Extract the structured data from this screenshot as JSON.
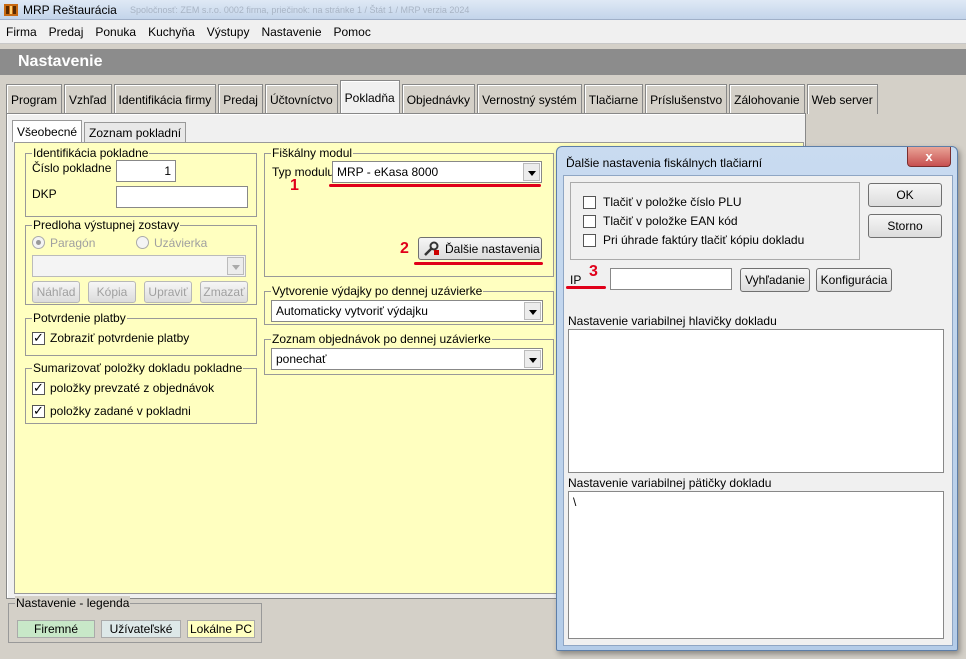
{
  "window": {
    "title": "MRP Reštaurácia",
    "title_extra": "Spoločnosť: ZEM s.r.o. 0002 firma, priečinok: na stránke 1 / Štát 1 / MRP verzia 2024",
    "icon": "app-logo-icon"
  },
  "menu": [
    {
      "label": "Firma"
    },
    {
      "label": "Predaj"
    },
    {
      "label": "Ponuka"
    },
    {
      "label": "Kuchyňa"
    },
    {
      "label": "Výstupy"
    },
    {
      "label": "Nastavenie"
    },
    {
      "label": "Pomoc"
    }
  ],
  "header": {
    "title": "Nastavenie"
  },
  "tabs": [
    {
      "label": "Program"
    },
    {
      "label": "Vzhľad"
    },
    {
      "label": "Identifikácia firmy"
    },
    {
      "label": "Predaj"
    },
    {
      "label": "Účtovníctvo"
    },
    {
      "label": "Pokladňa",
      "active": true
    },
    {
      "label": "Objednávky"
    },
    {
      "label": "Vernostný systém"
    },
    {
      "label": "Tlačiarne"
    },
    {
      "label": "Príslušenstvo"
    },
    {
      "label": "Zálohovanie"
    },
    {
      "label": "Web server"
    }
  ],
  "subtabs": [
    {
      "label": "Všeobecné",
      "active": true
    },
    {
      "label": "Zoznam pokladní"
    }
  ],
  "ident": {
    "legend": "Identifikácia pokladne",
    "cislo_label": "Číslo pokladne",
    "cislo_value": "1",
    "dkp_label": "DKP",
    "dkp_value": ""
  },
  "predloha": {
    "legend": "Predloha výstupnej zostavy",
    "radio_paragon": "Paragón",
    "radio_uzavierka": "Uzávierka",
    "combo_value": "",
    "btn_nahlad": "Náhľad",
    "btn_kopia": "Kópia",
    "btn_upravit": "Upraviť",
    "btn_zmazat": "Zmazať"
  },
  "potvrdenie": {
    "legend": "Potvrdenie platby",
    "checkbox": "Zobraziť potvrdenie platby"
  },
  "sumarizovat": {
    "legend": "Sumarizovať položky dokladu pokladne",
    "cb1": "položky prevzaté z objednávok",
    "cb2": "položky zadané v pokladni"
  },
  "fiskal": {
    "legend": "Fiškálny modul",
    "typ_label": "Typ modulu",
    "typ_value": "MRP - eKasa 8000",
    "btn_dalsie": "Ďalšie nastavenia"
  },
  "vydajky": {
    "legend": "Vytvorenie výdajky po dennej uzávierke",
    "value": "Automaticky vytvoriť výdajku"
  },
  "objednavky": {
    "legend": "Zoznam objednávok po dennej uzávierke",
    "value": "ponechať"
  },
  "annotations": {
    "n1": "1",
    "n2": "2",
    "n3": "3",
    "color": "#e0001a"
  },
  "legend": {
    "title": "Nastavenie - legenda",
    "firemne": "Firemné",
    "uzivatelske": "Užívateľské",
    "lokalne": "Lokálne PC",
    "colors": {
      "firemne": "#c8e8c8",
      "uzivatelske": "#dde8e8",
      "lokalne": "#ffffc0"
    }
  },
  "dialog": {
    "title": "Ďalšie nastavenia fiskálnych tlačiarní",
    "close": "x",
    "cb_plu": "Tlačiť v položke číslo PLU",
    "cb_ean": "Tlačiť v položke EAN kód",
    "cb_kopia": "Pri úhrade faktúry tlačiť kópiu dokladu",
    "ip_label": "IP",
    "ip_value": "",
    "btn_vyhladanie": "Vyhľadanie",
    "btn_konfiguracia": "Konfigurácia",
    "btn_ok": "OK",
    "btn_storno": "Storno",
    "hlavicka_label": "Nastavenie variabilnej hlavičky dokladu",
    "hlavicka_value": "",
    "paticka_label": "Nastavenie variabilnej pätičky dokladu",
    "paticka_value": "\\"
  }
}
